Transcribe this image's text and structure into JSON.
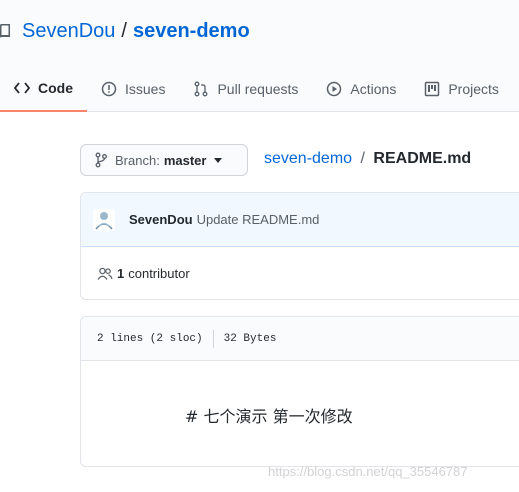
{
  "repo": {
    "owner": "SevenDou",
    "separator": "/",
    "name": "seven-demo"
  },
  "tabs": [
    {
      "label": "Code",
      "icon": "code-icon",
      "selected": true
    },
    {
      "label": "Issues",
      "icon": "issue-icon"
    },
    {
      "label": "Pull requests",
      "icon": "pull-request-icon"
    },
    {
      "label": "Actions",
      "icon": "play-icon"
    },
    {
      "label": "Projects",
      "icon": "project-icon"
    }
  ],
  "branch": {
    "prefix": "Branch:",
    "name": "master"
  },
  "breadcrumb": {
    "repo": "seven-demo",
    "separator": "/",
    "file": "README.md"
  },
  "commit": {
    "author": "SevenDou",
    "message": "Update README.md"
  },
  "contributors": {
    "count": "1",
    "label": "contributor"
  },
  "file": {
    "lines": "2 lines (2 sloc)",
    "size": "32 Bytes",
    "content": "# 七个演示 第一次修改"
  },
  "watermark": "https://blog.csdn.net/qq_35546787",
  "colors": {
    "link": "#0366d6",
    "selected_tab_underline": "#f9826c",
    "commit_bar": "#f1f8ff"
  }
}
